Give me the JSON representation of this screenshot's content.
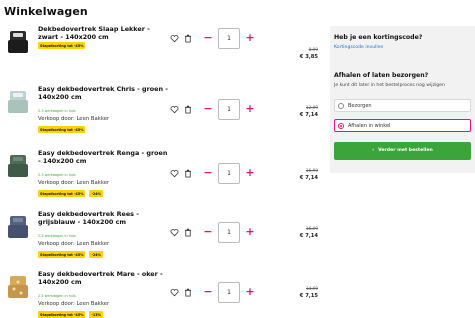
{
  "page": {
    "title": "Winkelwagen"
  },
  "cart": {
    "items": [
      {
        "name": "Dekbedovertrek Slaap Lekker - zwart - 140x200 cm",
        "delivery": "",
        "seller": "",
        "badges": [
          "Stapelkorting tot -45%"
        ],
        "quantity": "1",
        "old_price": "8,99",
        "price": "€ 3,85"
      },
      {
        "name": "Easy dekbedovertrek Chris - groen - 140x200 cm",
        "delivery": "2-3 werkdagen in huis",
        "seller": "Verkoop door: Leen Bakker",
        "badges": [
          "Stapelkorting tot -45%"
        ],
        "quantity": "1",
        "old_price": "12,99",
        "price": "€ 7,14"
      },
      {
        "name": "Easy dekbedovertrek Renga - groen - 140x200 cm",
        "delivery": "2-3 werkdagen in huis",
        "seller": "Verkoop door: Leen Bakker",
        "badges": [
          "Stapelkorting tot -45%",
          "-24%"
        ],
        "quantity": "1",
        "old_price": "16,99",
        "price": "€ 7,14"
      },
      {
        "name": "Easy dekbedovertrek Rees - grijsblauw - 140x200 cm",
        "delivery": "2-3 werkdagen in huis",
        "seller": "Verkoop door: Leen Bakker",
        "badges": [
          "Stapelkorting tot -45%",
          "-24%"
        ],
        "quantity": "1",
        "old_price": "16,99",
        "price": "€ 7,14"
      },
      {
        "name": "Easy dekbedovertrek Mare - oker - 140x200 cm",
        "delivery": "2-3 werkdagen in huis",
        "seller": "Verkoop door: Leen Bakker",
        "badges": [
          "Stapelkorting tot -45%",
          "-13%"
        ],
        "quantity": "1",
        "old_price": "14,99",
        "price": "€ 7,15"
      }
    ]
  },
  "sidebar": {
    "discount_heading": "Heb je een kortingscode?",
    "discount_link": "Kortingscode invullen",
    "delivery_heading": "Afhalen of laten bezorgen?",
    "delivery_sub": "Je kunt dit later in het bestelproces nog wijzigen",
    "options": [
      {
        "label": "Bezorgen",
        "selected": false
      },
      {
        "label": "Afhalen in winkel",
        "selected": true
      }
    ],
    "continue_label": "Verder met bestellen"
  },
  "colors": {
    "accent": "#e0167a",
    "primary_button": "#3ba53b",
    "badge": "#ffd400",
    "link": "#1a73c9"
  },
  "icons": [
    "heart-icon",
    "trash-icon",
    "minus-icon",
    "plus-icon",
    "chevron-right-icon"
  ],
  "product_colors": [
    "#2b2b2b",
    "#bcd3cc",
    "#4f6b57",
    "#55627f",
    "#d6a85a"
  ]
}
